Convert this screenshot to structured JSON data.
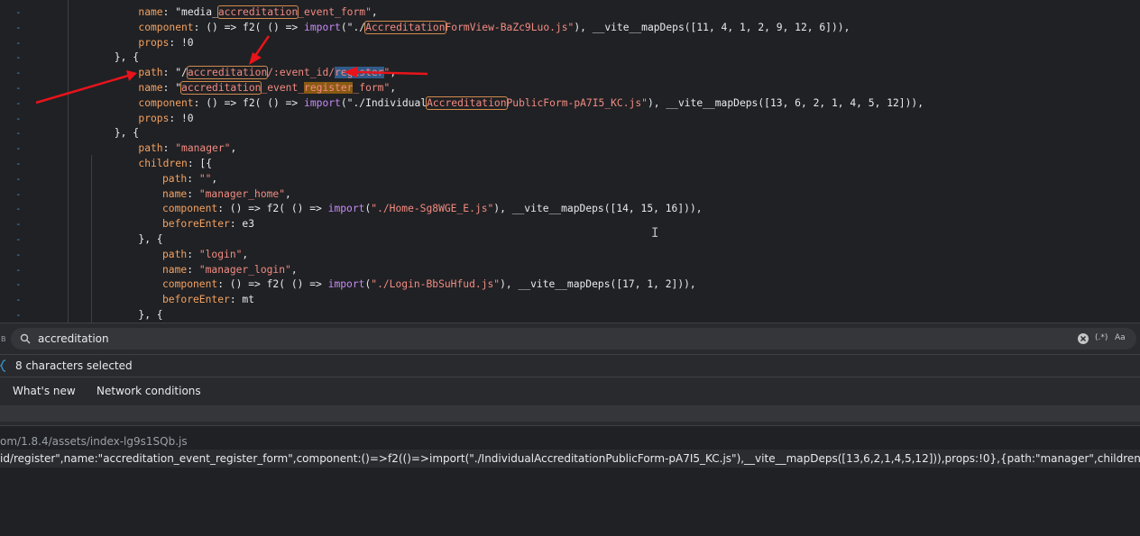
{
  "editor": {
    "lines": [
      {
        "indent": 8,
        "parts": [
          [
            "k",
            "name"
          ],
          [
            "p",
            ": \"media_"
          ],
          [
            "hlstr",
            "accreditation"
          ],
          [
            "str",
            "_event_form\""
          ],
          [
            "p",
            ","
          ]
        ]
      },
      {
        "indent": 8,
        "parts": [
          [
            "k",
            "component"
          ],
          [
            "p",
            ": () => f2( () => "
          ],
          [
            "kw",
            "import"
          ],
          [
            "p",
            "(\"./"
          ],
          [
            "hlstr",
            "Accreditation"
          ],
          [
            "str",
            "FormView-BaZc9Luo.js\""
          ],
          [
            "p",
            "), __vite__mapDeps([11, 4, 1, 2, 9, 12, 6])),"
          ]
        ]
      },
      {
        "indent": 8,
        "parts": [
          [
            "k",
            "props"
          ],
          [
            "p",
            ": !0"
          ]
        ]
      },
      {
        "indent": 6,
        "parts": [
          [
            "p",
            "}, {"
          ]
        ]
      },
      {
        "indent": 8,
        "parts": [
          [
            "k",
            "path"
          ],
          [
            "p",
            ": \"/"
          ],
          [
            "hlstr",
            "accreditation"
          ],
          [
            "str",
            "/:event_id/"
          ],
          [
            "selstr",
            "register"
          ],
          [
            "str",
            "\""
          ],
          [
            "p",
            ","
          ]
        ]
      },
      {
        "indent": 8,
        "parts": [
          [
            "k",
            "name"
          ],
          [
            "p",
            ": \""
          ],
          [
            "hlstr",
            "accreditation"
          ],
          [
            "str",
            "_event_"
          ],
          [
            "fillstr",
            "register"
          ],
          [
            "str",
            "_form\""
          ],
          [
            "p",
            ","
          ]
        ]
      },
      {
        "indent": 8,
        "parts": [
          [
            "k",
            "component"
          ],
          [
            "p",
            ": () => f2( () => "
          ],
          [
            "kw",
            "import"
          ],
          [
            "p",
            "(\"./Individual"
          ],
          [
            "hlstr",
            "Accreditation"
          ],
          [
            "str",
            "PublicForm-pA7I5_KC.js\""
          ],
          [
            "p",
            "), __vite__mapDeps([13, 6, 2, 1, 4, 5, 12])),"
          ]
        ]
      },
      {
        "indent": 8,
        "parts": [
          [
            "k",
            "props"
          ],
          [
            "p",
            ": !0"
          ]
        ]
      },
      {
        "indent": 6,
        "parts": [
          [
            "p",
            "}, {"
          ]
        ]
      },
      {
        "indent": 8,
        "parts": [
          [
            "k",
            "path"
          ],
          [
            "p",
            ": "
          ],
          [
            "str",
            "\"manager\""
          ],
          [
            "p",
            ","
          ]
        ]
      },
      {
        "indent": 8,
        "parts": [
          [
            "k",
            "children"
          ],
          [
            "p",
            ": [{"
          ]
        ]
      },
      {
        "indent": 10,
        "parts": [
          [
            "k",
            "path"
          ],
          [
            "p",
            ": "
          ],
          [
            "str",
            "\"\""
          ],
          [
            "p",
            ","
          ]
        ]
      },
      {
        "indent": 10,
        "parts": [
          [
            "k",
            "name"
          ],
          [
            "p",
            ": "
          ],
          [
            "str",
            "\"manager_home\""
          ],
          [
            "p",
            ","
          ]
        ]
      },
      {
        "indent": 10,
        "parts": [
          [
            "k",
            "component"
          ],
          [
            "p",
            ": () => f2( () => "
          ],
          [
            "kw",
            "import"
          ],
          [
            "p",
            "("
          ],
          [
            "str",
            "\"./Home-Sg8WGE_E.js\""
          ],
          [
            "p",
            "), __vite__mapDeps([14, 15, 16])),"
          ]
        ]
      },
      {
        "indent": 10,
        "parts": [
          [
            "k",
            "beforeEnter"
          ],
          [
            "p",
            ": e3"
          ]
        ]
      },
      {
        "indent": 8,
        "parts": [
          [
            "p",
            "}, {"
          ]
        ]
      },
      {
        "indent": 10,
        "parts": [
          [
            "k",
            "path"
          ],
          [
            "p",
            ": "
          ],
          [
            "str",
            "\"login\""
          ],
          [
            "p",
            ","
          ]
        ]
      },
      {
        "indent": 10,
        "parts": [
          [
            "k",
            "name"
          ],
          [
            "p",
            ": "
          ],
          [
            "str",
            "\"manager_login\""
          ],
          [
            "p",
            ","
          ]
        ]
      },
      {
        "indent": 10,
        "parts": [
          [
            "k",
            "component"
          ],
          [
            "p",
            ": () => f2( () => "
          ],
          [
            "kw",
            "import"
          ],
          [
            "p",
            "("
          ],
          [
            "str",
            "\"./Login-BbSuHfud.js\""
          ],
          [
            "p",
            "), __vite__mapDeps([17, 1, 2])),"
          ]
        ]
      },
      {
        "indent": 10,
        "parts": [
          [
            "k",
            "beforeEnter"
          ],
          [
            "p",
            ": mt"
          ]
        ]
      },
      {
        "indent": 8,
        "parts": [
          [
            "p",
            "}, {"
          ]
        ]
      }
    ],
    "gutter_mark": "-"
  },
  "search": {
    "query": "accreditation",
    "icons": {
      "search": "search-icon",
      "clear": "clear-icon",
      "regex": "(.*)",
      "case": "Aa"
    }
  },
  "status": {
    "text": "8 characters selected"
  },
  "drawer": {
    "tabs": [
      "What's new",
      "Network conditions"
    ]
  },
  "results": {
    "file": "om/1.8.4/assets/index-lg9s1SQb.js",
    "match": "id/register\",name:\"accreditation_event_register_form\",component:()=>f2(()=>import(\"./IndividualAccreditationPublicForm-pA7I5_KC.js\"),__vite__mapDeps([13,6,2,1,4,5,12])),props:!0},{path:\"manager\",children:[{path:\"\",name:\"manager_home\",co"
  },
  "colors": {
    "annotation_arrow": "#e8141b",
    "selection": "#2f5a8a",
    "accent": "#3a8fc7"
  }
}
